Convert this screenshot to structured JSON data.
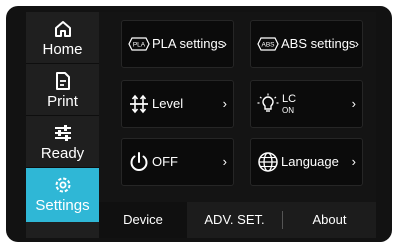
{
  "sidebar": {
    "items": [
      {
        "label": "Home",
        "icon": "home-icon",
        "active": false
      },
      {
        "label": "Print",
        "icon": "document-icon",
        "active": false
      },
      {
        "label": "Ready",
        "icon": "sliders-icon",
        "active": false
      },
      {
        "label": "Settings",
        "icon": "gear-icon",
        "active": true
      }
    ],
    "active_color": "#2fb7d6"
  },
  "tiles": [
    {
      "label": "PLA settings",
      "badge": "PLA",
      "chevron": "›",
      "icon": "pla-badge-icon"
    },
    {
      "label": "ABS settings",
      "badge": "ABS",
      "chevron": "›",
      "icon": "abs-badge-icon"
    },
    {
      "label": "Level",
      "chevron": "›",
      "icon": "level-arrows-icon"
    },
    {
      "label": "LC",
      "sublabel": "ON",
      "chevron": "›",
      "icon": "light-bulb-icon"
    },
    {
      "label": "OFF",
      "chevron": "›",
      "icon": "power-icon"
    },
    {
      "label": "Language",
      "chevron": "›",
      "icon": "globe-icon"
    }
  ],
  "tabs": [
    {
      "label": "Device",
      "active": true
    },
    {
      "label": "ADV. SET.",
      "active": false
    },
    {
      "label": "About",
      "active": false
    }
  ]
}
